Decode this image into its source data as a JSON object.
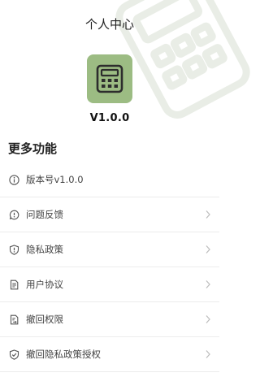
{
  "header": {
    "title": "个人中心"
  },
  "app": {
    "icon": "calculator-icon",
    "version": "V1.0.0",
    "accent_color": "#9cbc83"
  },
  "section": {
    "title": "更多功能"
  },
  "menu": {
    "items": [
      {
        "label": "版本号v1.0.0",
        "icon": "info-icon",
        "chevron": false
      },
      {
        "label": "问题反馈",
        "icon": "feedback-icon",
        "chevron": true
      },
      {
        "label": "隐私政策",
        "icon": "shield-alert-icon",
        "chevron": true
      },
      {
        "label": "用户协议",
        "icon": "document-icon",
        "chevron": true
      },
      {
        "label": "撤回权限",
        "icon": "revoke-icon",
        "chevron": true
      },
      {
        "label": "撤回隐私政策授权",
        "icon": "shield-check-icon",
        "chevron": true
      }
    ]
  }
}
